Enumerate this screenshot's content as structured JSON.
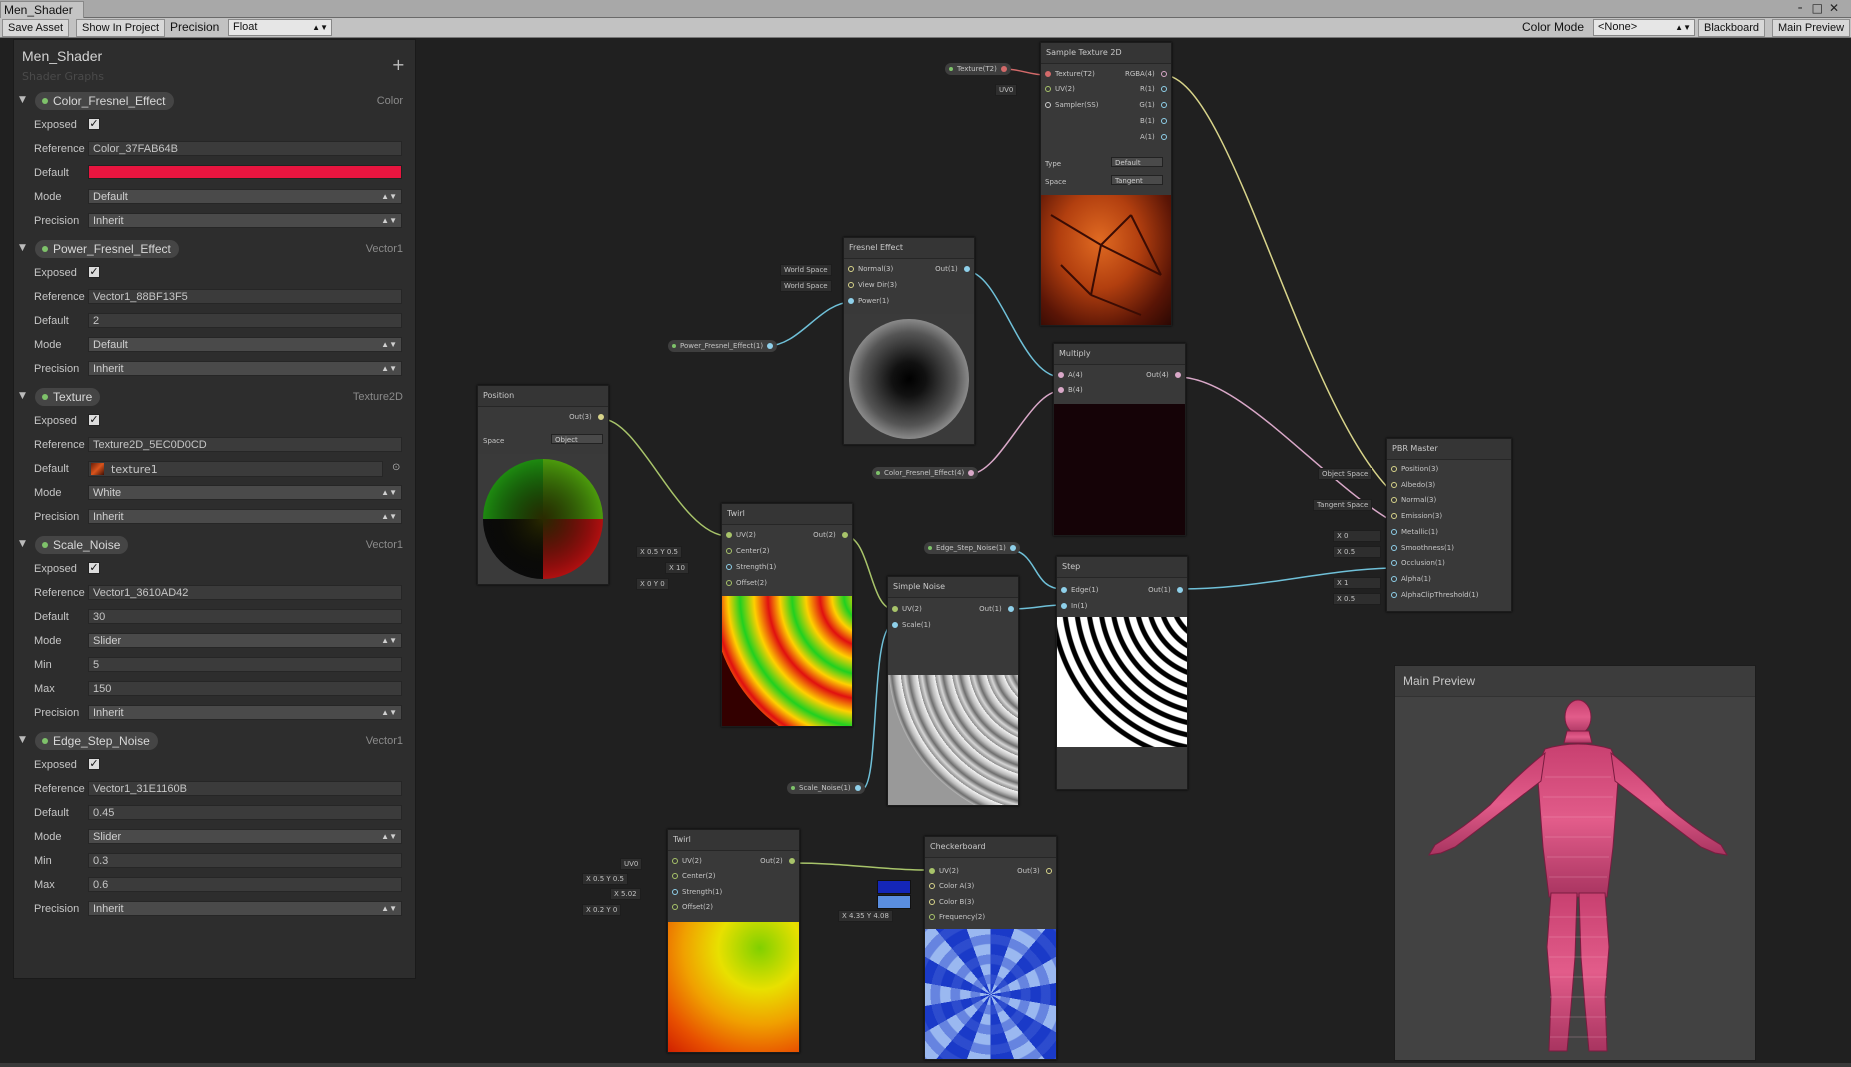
{
  "window": {
    "tab_title": "Men_Shader",
    "controls": "╴□✕"
  },
  "toolbar": {
    "save_asset": "Save Asset",
    "show_in_project": "Show In Project",
    "precision_label": "Precision",
    "precision_value": "Float",
    "color_mode_label": "Color Mode",
    "color_mode_value": "<None>",
    "blackboard_btn": "Blackboard",
    "main_preview_btn": "Main Preview"
  },
  "blackboard": {
    "title": "Men_Shader",
    "subtitle": "Shader Graphs",
    "add_icon": "+",
    "properties": [
      {
        "name": "Color_Fresnel_Effect",
        "type": "Color",
        "exposed": "✓",
        "reference": "Color_37FAB64B",
        "default_color": "#e8153f",
        "mode": "Default",
        "precision": "Inherit"
      },
      {
        "name": "Power_Fresnel_Effect",
        "type": "Vector1",
        "exposed": "✓",
        "reference": "Vector1_88BF13F5",
        "default": "2",
        "mode": "Default",
        "precision": "Inherit"
      },
      {
        "name": "Texture",
        "type": "Texture2D",
        "exposed": "✓",
        "reference": "Texture2D_5EC0D0CD",
        "default": "texture1",
        "mode": "White",
        "precision": "Inherit"
      },
      {
        "name": "Scale_Noise",
        "type": "Vector1",
        "exposed": "✓",
        "reference": "Vector1_3610AD42",
        "default": "30",
        "mode": "Slider",
        "min": "5",
        "max": "150",
        "precision": "Inherit"
      },
      {
        "name": "Edge_Step_Noise",
        "type": "Vector1",
        "exposed": "✓",
        "reference": "Vector1_31E1160B",
        "default": "0.45",
        "mode": "Slider",
        "min": "0.3",
        "max": "0.6",
        "precision": "Inherit"
      }
    ],
    "labels": {
      "exposed": "Exposed",
      "reference": "Reference",
      "default": "Default",
      "mode": "Mode",
      "precision": "Precision",
      "min": "Min",
      "max": "Max"
    }
  },
  "nodes": {
    "sample_texture": {
      "title": "Sample Texture 2D",
      "in": [
        "Texture(T2)",
        "UV(2)",
        "Sampler(SS)"
      ],
      "out": [
        "RGBA(4)",
        "R(1)",
        "G(1)",
        "B(1)",
        "A(1)"
      ],
      "type_label": "Type",
      "type_value": "Default",
      "space_label": "Space",
      "space_value": "Tangent",
      "uv_box": "UV0"
    },
    "texture_pill": "Texture(T2)",
    "fresnel": {
      "title": "Fresnel Effect",
      "in": [
        "Normal(3)",
        "View Dir(3)",
        "Power(1)"
      ],
      "out": "Out(1)",
      "box1": "World Space",
      "box2": "World Space"
    },
    "power_pill": "Power_Fresnel_Effect(1)",
    "multiply": {
      "title": "Multiply",
      "in": [
        "A(4)",
        "B(4)"
      ],
      "out": "Out(4)"
    },
    "color_pill": "Color_Fresnel_Effect(4)",
    "position": {
      "title": "Position",
      "out": "Out(3)",
      "space_label": "Space",
      "space_value": "Object"
    },
    "twirl1": {
      "title": "Twirl",
      "in": [
        "UV(2)",
        "Center(2)",
        "Strength(1)",
        "Offset(2)"
      ],
      "out": "Out(2)",
      "center": "X  0.5   Y  0.5",
      "strength": "X  10",
      "offset": "X  0    Y  0"
    },
    "edge_pill": "Edge_Step_Noise(1)",
    "simple_noise": {
      "title": "Simple Noise",
      "in": [
        "UV(2)",
        "Scale(1)"
      ],
      "out": "Out(1)"
    },
    "step": {
      "title": "Step",
      "in": [
        "Edge(1)",
        "In(1)"
      ],
      "out": "Out(1)"
    },
    "scale_pill": "Scale_Noise(1)",
    "pbr": {
      "title": "PBR Master",
      "in": [
        "Position(3)",
        "Albedo(3)",
        "Normal(3)",
        "Emission(3)",
        "Metallic(1)",
        "Smoothness(1)",
        "Occlusion(1)",
        "Alpha(1)",
        "AlphaClipThreshold(1)"
      ],
      "box_obj": "Object Space",
      "box_tan": "Tangent Space",
      "metallic": "X  0",
      "smooth": "X  0.5",
      "alpha": "X  1",
      "clip": "X  0.5"
    },
    "twirl2": {
      "title": "Twirl",
      "in": [
        "UV(2)",
        "Center(2)",
        "Strength(1)",
        "Offset(2)"
      ],
      "out": "Out(2)",
      "uv": "UV0",
      "center": "X  0.5   Y  0.5",
      "strength": "X  5.02",
      "offset": "X  0.2   Y  0"
    },
    "checker": {
      "title": "Checkerboard",
      "in": [
        "UV(2)",
        "Color A(3)",
        "Color B(3)",
        "Frequency(2)"
      ],
      "out": "Out(3)",
      "freq": "X  4.35   Y  4.08",
      "color_a": "#1426b8",
      "color_b": "#5a8ee0"
    }
  },
  "main_preview": {
    "title": "Main Preview"
  },
  "colors": {
    "wire_green": "#a8c46a",
    "wire_blue": "#6fc0d8",
    "wire_pink": "#d9a8c8",
    "wire_yellow": "#d8d48a"
  }
}
